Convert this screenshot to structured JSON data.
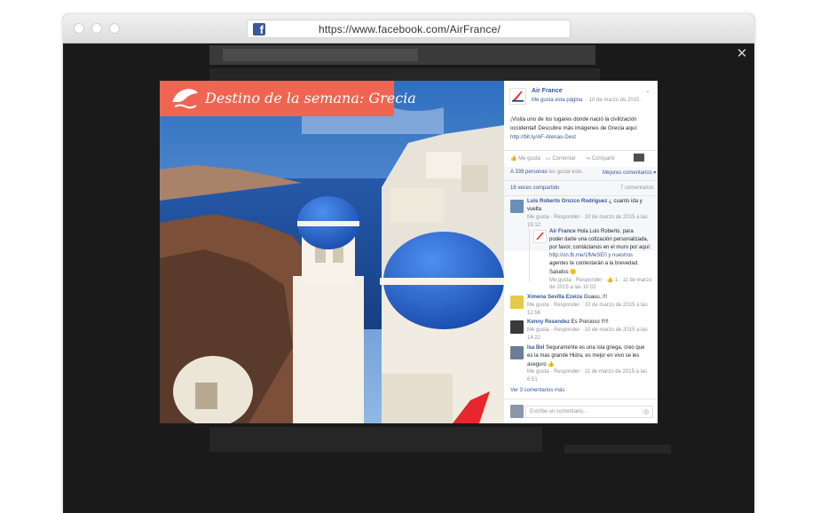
{
  "browser": {
    "url": "https://www.facebook.com/AirFrance/"
  },
  "photo": {
    "banner_text": "Destino de la semana: Grecia",
    "colors": {
      "banner": "#ef6551",
      "sky": "#3f7ec7",
      "dome": "#1f62c9"
    }
  },
  "post": {
    "page_name": "Air France",
    "like_page": "Me gusta esta página",
    "date": "· 10 de marzo de 2015 ·",
    "text": [
      "¡Visita uno de los lugares donde nació la civilización",
      "occidental! Descubre más imágenes de Grecia aquí:"
    ],
    "link": "http://bit.ly/AF-Atenas-Dest",
    "actions": {
      "like": "Me gusta",
      "comment": "Comentar",
      "share": "Compartir"
    },
    "likes_count_link": "A 339 personas",
    "likes_suffix": " les gusta esto.",
    "top_comments": "Mejores comentarios ▾",
    "shared": "16 veces compartido",
    "comments_count": "7 comentarios"
  },
  "comments": [
    {
      "author": "Luis Roberto Orozco Rodriguez",
      "lines": [
        " ¿ cuanto ida y",
        "vuelta"
      ],
      "meta": [
        "Me gusta · Responder · 10 de marzo de 2015 a las",
        "15:12"
      ]
    },
    {
      "author": "Air France",
      "lines": [
        " Hola Luis Roberto, para",
        "poder darte una cotización personalizada,",
        "por favor, contáctanos en el muro por aquí:",
        "http://on.fb.me/1fMeSE0 y nuestros",
        "agentes te contestarán a la brevedad.",
        "Saludos 🙂"
      ],
      "meta": [
        "Me gusta · Responder · 👍 1 · 11 de marzo",
        "de 2015 a las 10:02"
      ]
    },
    {
      "author": "Ximena Sevilla Ezeiza",
      "lines": [
        " Guauu..!!!"
      ],
      "meta": [
        "Me gusta · Responder · 10 de marzo de 2015 a las",
        "12:56"
      ]
    },
    {
      "author": "Kenny Resendez",
      "lines": [
        " Es Precioso !!!!!"
      ],
      "meta": [
        "Me gusta · Responder · 10 de marzo de 2015 a las",
        "14:22"
      ]
    },
    {
      "author": "Isa Bel",
      "lines": [
        " Seguramente es una isla griega, creo que",
        "es la mas grande Hidra, es mejor en vivo se les",
        "aseguro 👍"
      ],
      "meta": [
        "Me gusta · Responder · 11 de marzo de 2015 a las",
        "6:51"
      ]
    }
  ],
  "more_comments": "Ver 3 comentarios más",
  "comment_placeholder": "Escribe un comentario...",
  "icons": [
    "facebook-icon",
    "close-icon",
    "air-france-logo-icon",
    "chevron-down-icon",
    "like-icon",
    "comment-icon",
    "share-icon",
    "camera-icon"
  ]
}
